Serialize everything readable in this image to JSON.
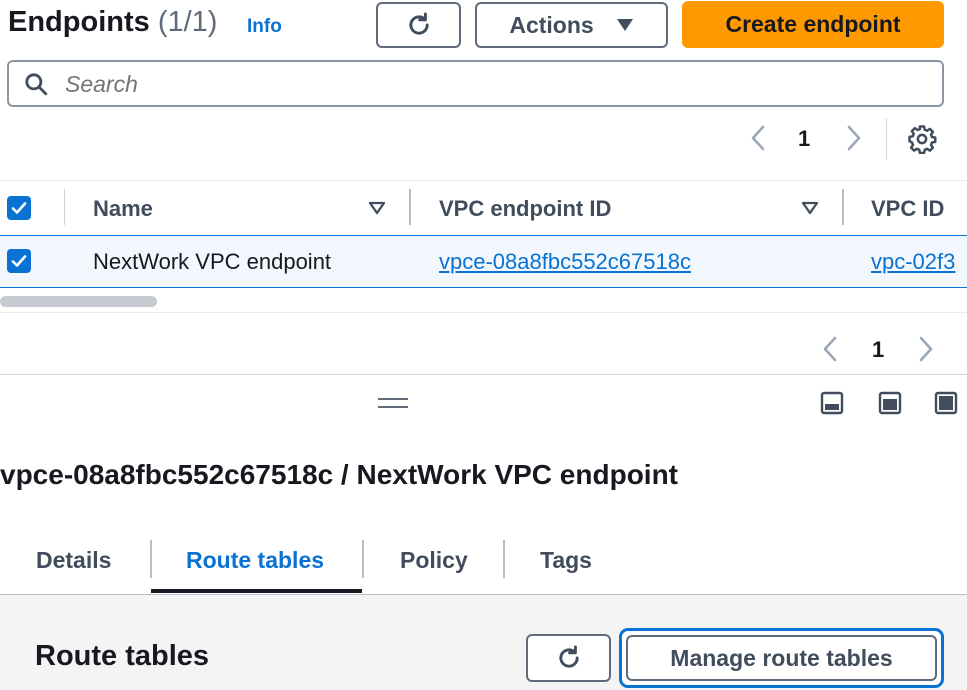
{
  "header": {
    "title": "Endpoints",
    "count": "(1/1)",
    "info": "Info",
    "actions_label": "Actions",
    "create_label": "Create endpoint"
  },
  "search": {
    "placeholder": "Search"
  },
  "pagination_top": {
    "page": "1"
  },
  "table": {
    "columns": [
      "Name",
      "VPC endpoint ID",
      "VPC ID"
    ],
    "rows": [
      {
        "name": "NextWork VPC endpoint",
        "endpoint_id": "vpce-08a8fbc552c67518c",
        "vpc_id": "vpc-02f3"
      }
    ]
  },
  "pagination_bottom": {
    "page": "1"
  },
  "detail": {
    "title": "vpce-08a8fbc552c67518c / NextWork VPC endpoint",
    "tabs": [
      "Details",
      "Route tables",
      "Policy",
      "Tags"
    ],
    "active_tab": "Route tables",
    "section_title": "Route tables",
    "manage_label": "Manage route tables"
  },
  "colors": {
    "primary": "#ff9900",
    "link": "#0972d3",
    "selected_row": "#f2f8fd"
  }
}
